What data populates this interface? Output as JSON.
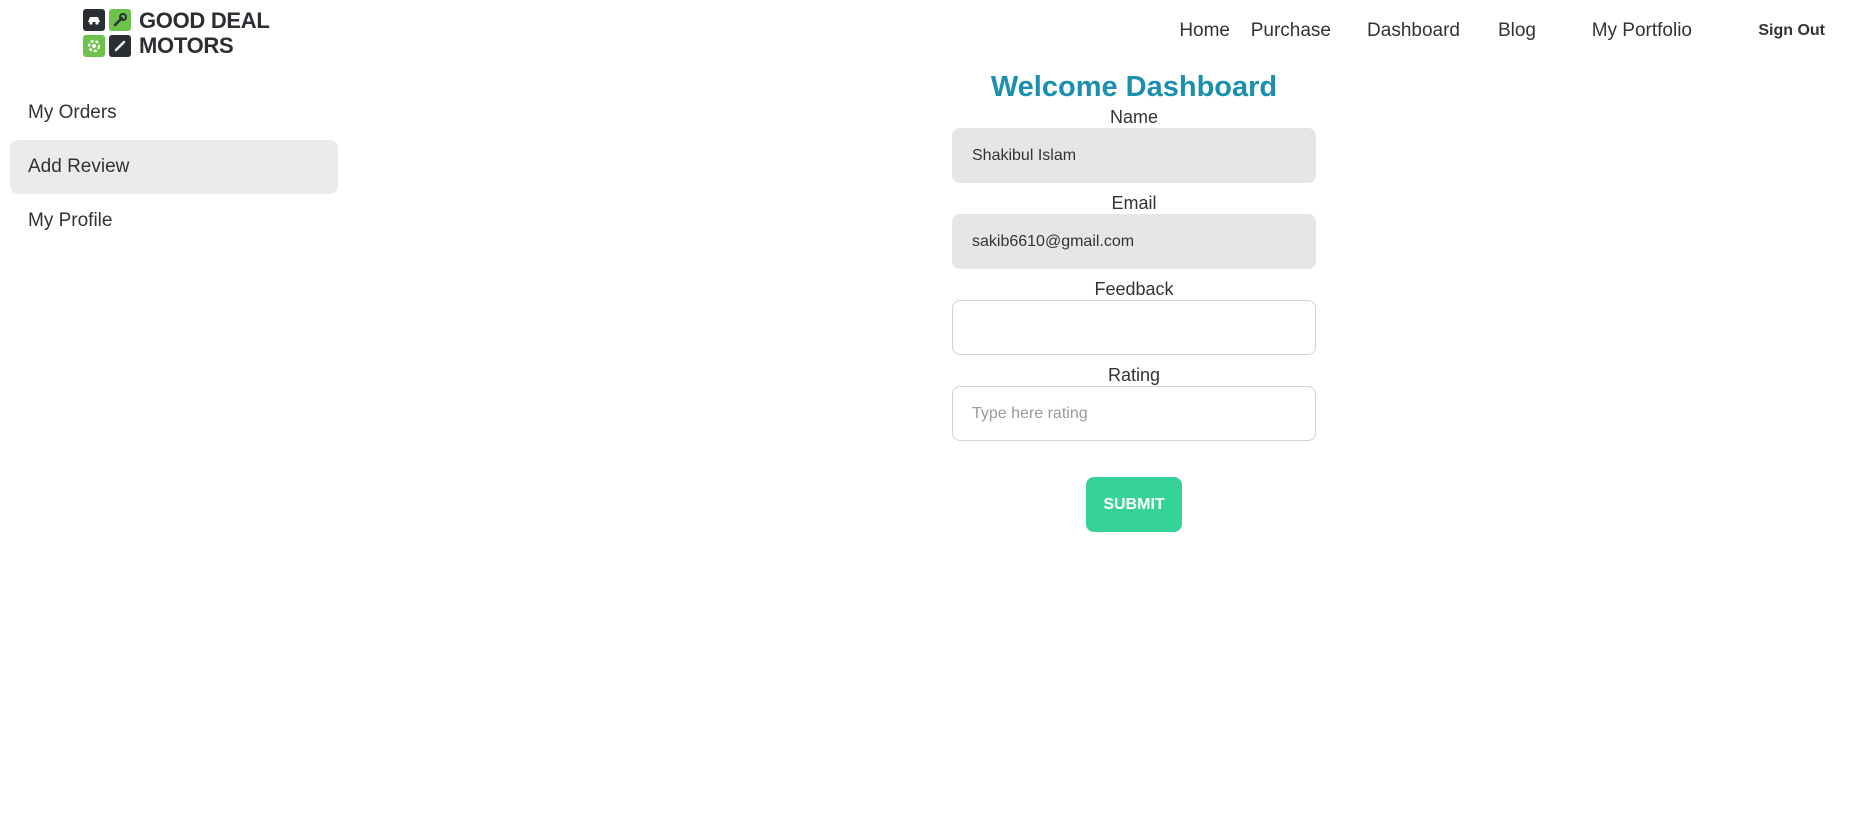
{
  "brand": {
    "line1": "GOOD DEAL",
    "line2": "MOTORS",
    "icons": [
      "car-icon",
      "wrench-icon",
      "gear-icon",
      "screwdriver-icon"
    ],
    "colors": {
      "dark": "#2b2f33",
      "green": "#6cc24a"
    }
  },
  "nav": {
    "items": [
      "Home",
      "Purchase",
      "Dashboard",
      "Blog",
      "My Portfolio"
    ],
    "signout": "Sign Out"
  },
  "sidebar": {
    "items": [
      {
        "label": "My Orders",
        "active": false
      },
      {
        "label": "Add Review",
        "active": true
      },
      {
        "label": "My Profile",
        "active": false
      }
    ]
  },
  "form": {
    "title": "Welcome Dashboard",
    "name": {
      "label": "Name",
      "value": "Shakibul Islam"
    },
    "email": {
      "label": "Email",
      "value": "sakib6610@gmail.com"
    },
    "feedback": {
      "label": "Feedback",
      "value": ""
    },
    "rating": {
      "label": "Rating",
      "placeholder": "Type here rating"
    },
    "submit": "SUBMIT"
  },
  "colors": {
    "accent": "#1a8fae",
    "submit": "#36d399",
    "active_bg": "#ebebeb",
    "filled_bg": "#e6e6e6"
  }
}
